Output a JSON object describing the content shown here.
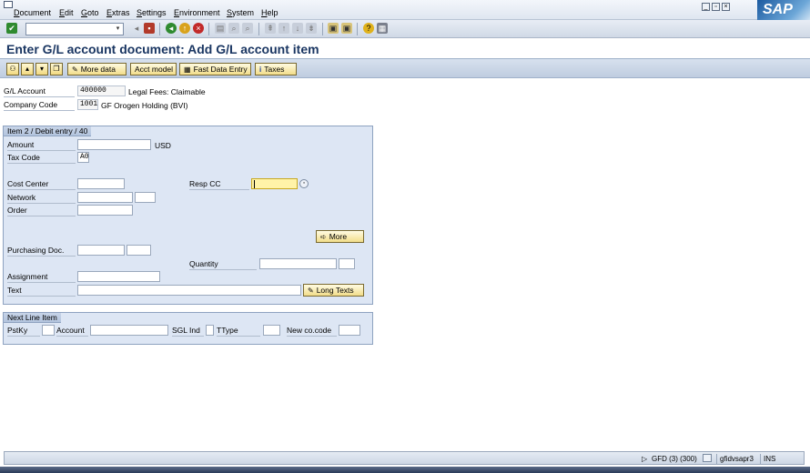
{
  "menu": {
    "items": [
      "Document",
      "Edit",
      "Goto",
      "Extras",
      "Settings",
      "Environment",
      "System",
      "Help"
    ]
  },
  "logo": "SAP",
  "title": "Enter G/L account document: Add G/L account item",
  "app_toolbar": {
    "more_data": "More data",
    "acct_model": "Acct model",
    "fast_data_entry": "Fast Data Entry",
    "taxes": "Taxes"
  },
  "header": {
    "gl_account_label": "G/L Account",
    "gl_account_value": "400000",
    "gl_account_desc": "Legal Fees: Claimable",
    "company_code_label": "Company Code",
    "company_code_value": "1001",
    "company_code_desc": "GF Orogen Holding (BVI)"
  },
  "item_group": {
    "title": "Item 2 / Debit entry / 40",
    "amount_label": "Amount",
    "amount_value": "",
    "currency": "USD",
    "tax_code_label": "Tax Code",
    "tax_code_value": "A0",
    "cost_center_label": "Cost Center",
    "resp_cc_label": "Resp CC",
    "network_label": "Network",
    "order_label": "Order",
    "more_button": "More",
    "purchasing_doc_label": "Purchasing Doc.",
    "quantity_label": "Quantity",
    "assignment_label": "Assignment",
    "text_label": "Text",
    "long_texts_button": "Long Texts"
  },
  "next_line_group": {
    "title": "Next Line Item",
    "pstky_label": "PstKy",
    "account_label": "Account",
    "sgl_ind_label": "SGL Ind",
    "ttype_label": "TType",
    "new_cocode_label": "New co.code"
  },
  "status_bar": {
    "system": "GFD (3) (300)",
    "server": "gfidvsapr3",
    "mode": "INS"
  }
}
